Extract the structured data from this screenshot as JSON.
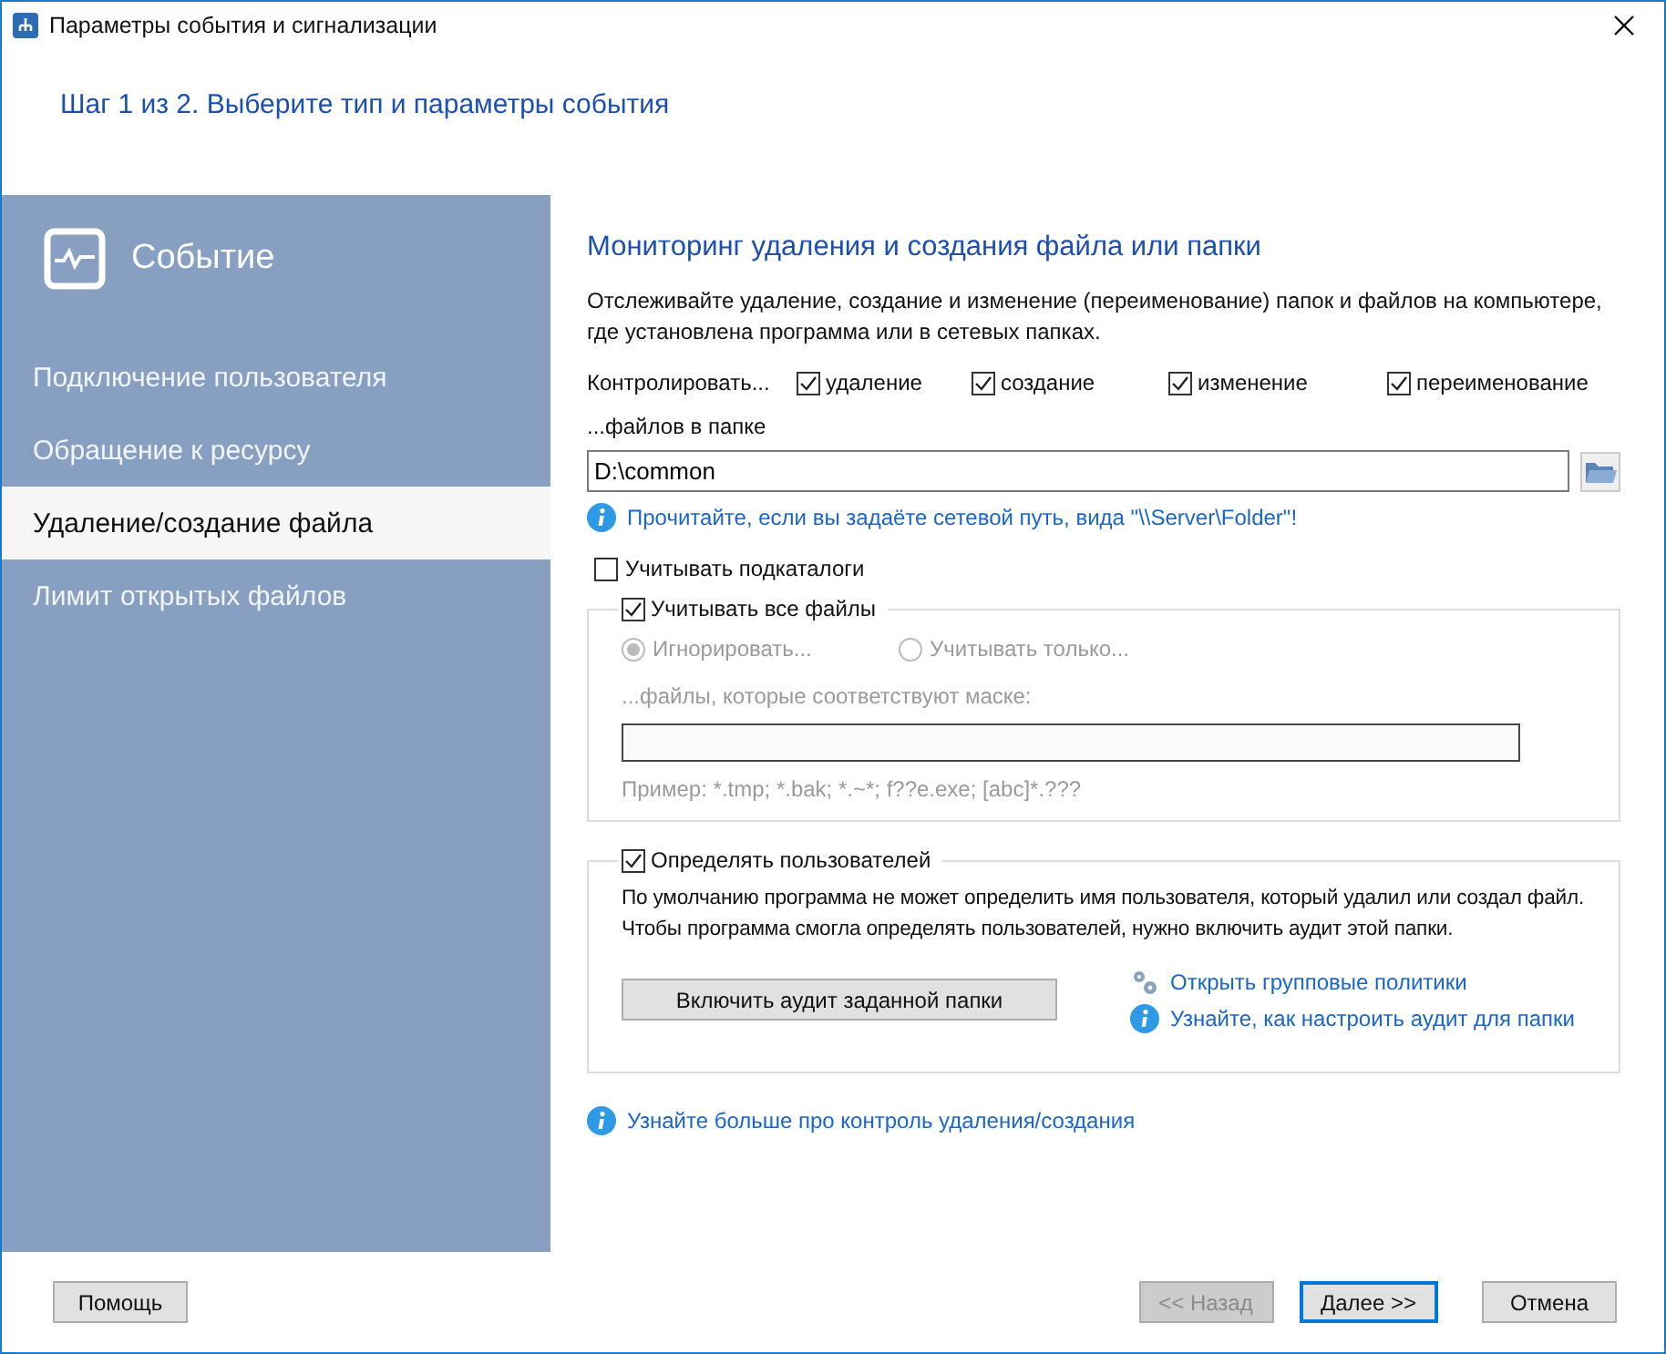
{
  "window": {
    "title": "Параметры события и сигнализации"
  },
  "step_title": "Шаг 1 из 2. Выберите тип и параметры события",
  "sidebar": {
    "heading": "Событие",
    "items": [
      {
        "label": "Подключение пользователя",
        "selected": false
      },
      {
        "label": "Обращение к ресурсу",
        "selected": false
      },
      {
        "label": "Удаление/создание файла",
        "selected": true
      },
      {
        "label": "Лимит открытых файлов",
        "selected": false
      }
    ]
  },
  "content": {
    "title": "Мониторинг удаления и создания файла или папки",
    "description": "Отслеживайте удаление, создание и изменение (переименование) папок и файлов на компьютере, где установлена программа или в сетевых папках.",
    "monitor_label": "Контролировать...",
    "monitor_options": [
      {
        "label": "удаление",
        "checked": true
      },
      {
        "label": "создание",
        "checked": true
      },
      {
        "label": "изменение",
        "checked": true
      },
      {
        "label": "переименование",
        "checked": true
      }
    ],
    "folder_label": "...файлов в папке",
    "folder_value": "D:\\common",
    "network_link": "Прочитайте, если вы задаёте сетевой путь, вида  \"\\\\Server\\Folder\"!",
    "subfolders": {
      "label": "Учитывать подкаталоги",
      "checked": false
    },
    "all_files": {
      "label": "Учитывать все файлы",
      "checked": true,
      "modes": [
        {
          "label": "Игнорировать...",
          "selected": true
        },
        {
          "label": "Учитывать только...",
          "selected": false
        }
      ],
      "mask_label": "...файлы, которые соответствуют маске:",
      "example": "Пример: *.tmp; *.bak; *.~*; f??e.exe; [abc]*.???"
    },
    "users": {
      "label": "Определять пользователей",
      "checked": true,
      "text": "По умолчанию программа не может определить имя пользователя, который удалил или создал файл. Чтобы программа смогла определять пользователей, нужно включить аудит этой папки.",
      "button": "Включить аудит заданной папки",
      "links": [
        {
          "kind": "policy",
          "label": "Открыть групповые политики"
        },
        {
          "kind": "info",
          "label": "Узнайте, как настроить аудит для папки"
        }
      ]
    },
    "more_link": "Узнайте больше про контроль удаления/создания"
  },
  "buttons": [
    {
      "label": "Помощь",
      "disabled": false,
      "default": false
    },
    {
      "label": "<< Назад",
      "disabled": true,
      "default": false
    },
    {
      "label": "Далее >>",
      "disabled": false,
      "default": true
    },
    {
      "label": "Отмена",
      "disabled": false,
      "default": false
    }
  ]
}
